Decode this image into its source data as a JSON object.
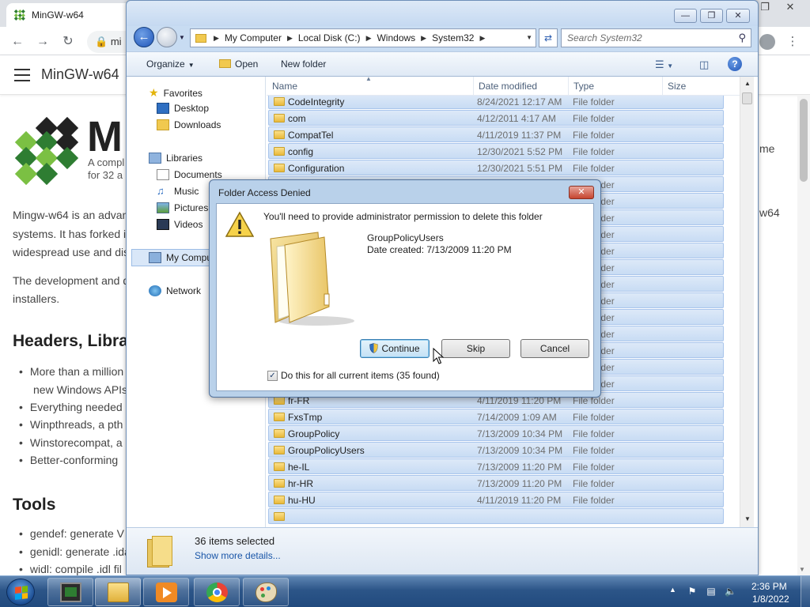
{
  "browser": {
    "tab_title": "MinGW-w64",
    "omnibox_text": "mi",
    "window_controls": [
      "❐",
      "✕"
    ],
    "site_name": "MinGW-w64",
    "logo_letter": "M",
    "logo_sub1": "A compl",
    "logo_sub2": "for 32 a",
    "para1_l1": "Mingw-w64 is an advan",
    "para1_l2": "systems. It has forked i",
    "para1_l3": "widespread use and dis",
    "para2_l1": "The development and d",
    "para2_l2": "installers.",
    "heading1": "Headers, Librar",
    "bullets": [
      "More than a million",
      "Everything needed",
      "Winpthreads, a pth",
      "Winstorecompat, a",
      "Better-conforming"
    ],
    "bullet1_cont": "new Windows APIs",
    "heading2": "Tools",
    "tools": [
      "gendef: generate V",
      "genidl: generate .ida",
      "widl: compile .idl fil"
    ],
    "right_me": "me",
    "right_w64": "w64"
  },
  "explorer": {
    "caption_buttons": [
      "—",
      "❐",
      "✕"
    ],
    "breadcrumb": [
      "My Computer",
      "Local Disk (C:)",
      "Windows",
      "System32"
    ],
    "search_placeholder": "Search System32",
    "commands": {
      "organize": "Organize",
      "open": "Open",
      "new_folder": "New folder"
    },
    "nav": {
      "favorites": "Favorites",
      "desktop": "Desktop",
      "downloads": "Downloads",
      "libraries": "Libraries",
      "documents": "Documents",
      "music": "Music",
      "pictures": "Pictures",
      "videos": "Videos",
      "computer": "My Computer",
      "network": "Network"
    },
    "columns": {
      "name": "Name",
      "date": "Date modified",
      "type": "Type",
      "size": "Size"
    },
    "rows": [
      {
        "name": "CodeIntegrity",
        "date": "8/24/2021 12:17 AM",
        "type": "File folder"
      },
      {
        "name": "com",
        "date": "4/12/2011 4:17 AM",
        "type": "File folder"
      },
      {
        "name": "CompatTel",
        "date": "4/11/2019 11:37 PM",
        "type": "File folder"
      },
      {
        "name": "config",
        "date": "12/30/2021 5:52 PM",
        "type": "File folder"
      },
      {
        "name": "Configuration",
        "date": "12/30/2021 5:51 PM",
        "type": "File folder"
      },
      {
        "name": "",
        "date": "",
        "type": "File folder"
      },
      {
        "name": "",
        "date": "",
        "type": "File folder"
      },
      {
        "name": "",
        "date": "",
        "type": "File folder"
      },
      {
        "name": "",
        "date": "",
        "type": "File folder"
      },
      {
        "name": "",
        "date": "",
        "type": "File folder"
      },
      {
        "name": "",
        "date": "",
        "type": "File folder"
      },
      {
        "name": "",
        "date": "",
        "type": "File folder"
      },
      {
        "name": "",
        "date": "",
        "type": "File folder"
      },
      {
        "name": "",
        "date": "",
        "type": "File folder"
      },
      {
        "name": "",
        "date": "",
        "type": "File folder"
      },
      {
        "name": "",
        "date": "",
        "type": "File folder"
      },
      {
        "name": "",
        "date": "",
        "type": "File folder"
      },
      {
        "name": "",
        "date": "",
        "type": "File folder"
      },
      {
        "name": "fr-FR",
        "date": "4/11/2019 11:20 PM",
        "type": "File folder"
      },
      {
        "name": "FxsTmp",
        "date": "7/14/2009 1:09 AM",
        "type": "File folder"
      },
      {
        "name": "GroupPolicy",
        "date": "7/13/2009 10:34 PM",
        "type": "File folder"
      },
      {
        "name": "GroupPolicyUsers",
        "date": "7/13/2009 10:34 PM",
        "type": "File folder"
      },
      {
        "name": "he-IL",
        "date": "7/13/2009 11:20 PM",
        "type": "File folder"
      },
      {
        "name": "hr-HR",
        "date": "7/13/2009 11:20 PM",
        "type": "File folder"
      },
      {
        "name": "hu-HU",
        "date": "4/11/2019 11:20 PM",
        "type": "File folder"
      },
      {
        "name": "",
        "date": "",
        "type": ""
      }
    ],
    "status_count": "36 items selected",
    "status_more": "Show more details..."
  },
  "dialog": {
    "title": "Folder Access Denied",
    "message": "You'll need to provide administrator permission to delete this folder",
    "folder_name": "GroupPolicyUsers",
    "date_created": "Date created: 7/13/2009 11:20 PM",
    "continue_label": "Continue",
    "skip_label": "Skip",
    "cancel_label": "Cancel",
    "checkbox_label": "Do this for all current items (35 found)",
    "checkbox_checked": true,
    "close_glyph": "✕"
  },
  "taskbar": {
    "time": "2:36 PM",
    "date": "1/8/2022",
    "pinned": [
      "terminal-app",
      "file-explorer",
      "media-player",
      "chrome-browser",
      "paint-app"
    ]
  },
  "colors": {
    "accent_blue": "#1e54b8",
    "selection_row": "#c8dcf4",
    "taskbar": "#2c5588"
  }
}
